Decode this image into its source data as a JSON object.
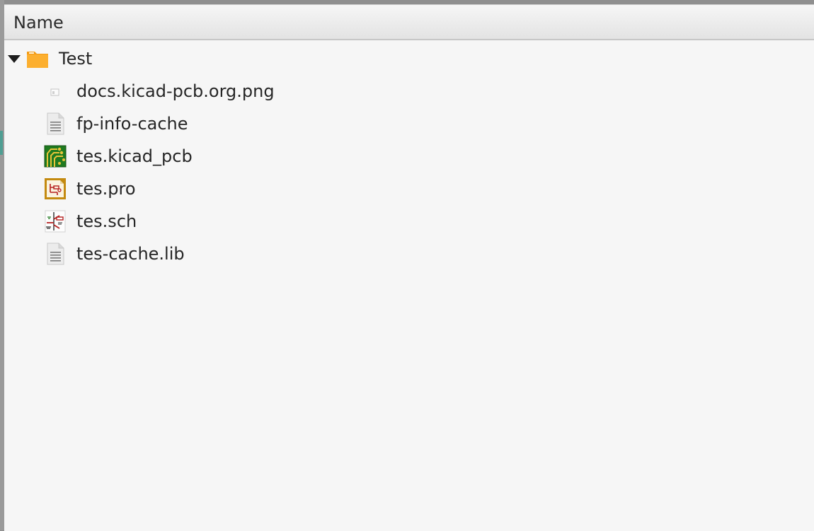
{
  "header": {
    "name_label": "Name"
  },
  "tree": {
    "folder": {
      "label": "Test",
      "expanded": true,
      "icon": "folder-icon",
      "color": "#f7a21b"
    },
    "items": [
      {
        "label": "docs.kicad-pcb.org.png",
        "icon": "image-file-icon"
      },
      {
        "label": "fp-info-cache",
        "icon": "text-file-icon"
      },
      {
        "label": "tes.kicad_pcb",
        "icon": "kicad-pcb-icon"
      },
      {
        "label": "tes.pro",
        "icon": "kicad-project-icon"
      },
      {
        "label": "tes.sch",
        "icon": "kicad-schematic-icon"
      },
      {
        "label": "tes-cache.lib",
        "icon": "text-file-icon"
      }
    ]
  },
  "colors": {
    "panel_background": "#f6f6f6",
    "pcb_green": "#1f7a1f",
    "project_gold": "#c48a10",
    "schematic_red": "#b51f1f"
  }
}
